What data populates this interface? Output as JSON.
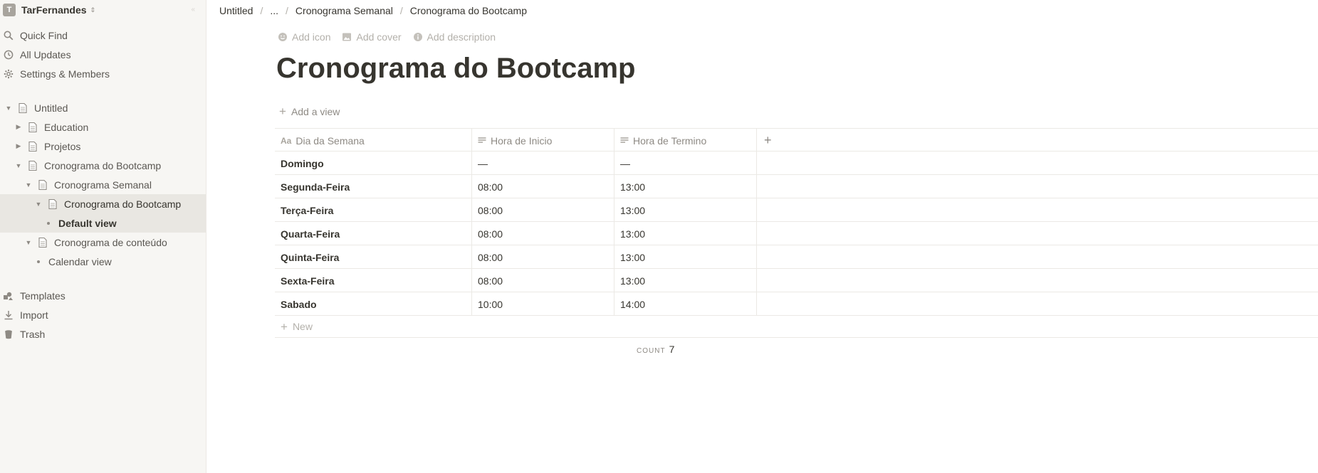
{
  "workspace": {
    "name": "TarFernandes",
    "avatar_letter": "T"
  },
  "sidebar": {
    "nav": [
      {
        "label": "Quick Find",
        "icon": "search-icon"
      },
      {
        "label": "All Updates",
        "icon": "clock-icon"
      },
      {
        "label": "Settings & Members",
        "icon": "gear-icon"
      }
    ],
    "tree": [
      {
        "label": "Untitled"
      },
      {
        "label": "Education"
      },
      {
        "label": "Projetos"
      },
      {
        "label": "Cronograma do Bootcamp"
      },
      {
        "label": "Cronograma Semanal"
      },
      {
        "label": "Cronograma do Bootcamp"
      },
      {
        "label": "Default view"
      },
      {
        "label": "Cronograma de conteúdo"
      },
      {
        "label": "Calendar view"
      }
    ],
    "footer": [
      {
        "label": "Templates",
        "icon": "templates-icon"
      },
      {
        "label": "Import",
        "icon": "import-icon"
      },
      {
        "label": "Trash",
        "icon": "trash-icon"
      }
    ]
  },
  "breadcrumb": [
    "Untitled",
    "...",
    "Cronograma Semanal",
    "Cronograma do Bootcamp"
  ],
  "page_actions": {
    "add_icon": "Add icon",
    "add_cover": "Add cover",
    "add_description": "Add description"
  },
  "page": {
    "title": "Cronograma do Bootcamp",
    "add_view": "Add a view"
  },
  "table": {
    "columns": [
      "Dia da Semana",
      "Hora de Inicio",
      "Hora de Termino"
    ],
    "rows": [
      [
        "Domingo",
        "—",
        "—"
      ],
      [
        "Segunda-Feira",
        "08:00",
        "13:00"
      ],
      [
        "Terça-Feira",
        "08:00",
        "13:00"
      ],
      [
        "Quarta-Feira",
        "08:00",
        "13:00"
      ],
      [
        "Quinta-Feira",
        "08:00",
        "13:00"
      ],
      [
        "Sexta-Feira",
        "08:00",
        "13:00"
      ],
      [
        "Sabado",
        "10:00",
        "14:00"
      ]
    ],
    "new_label": "New",
    "count_label": "COUNT",
    "count_value": "7"
  }
}
